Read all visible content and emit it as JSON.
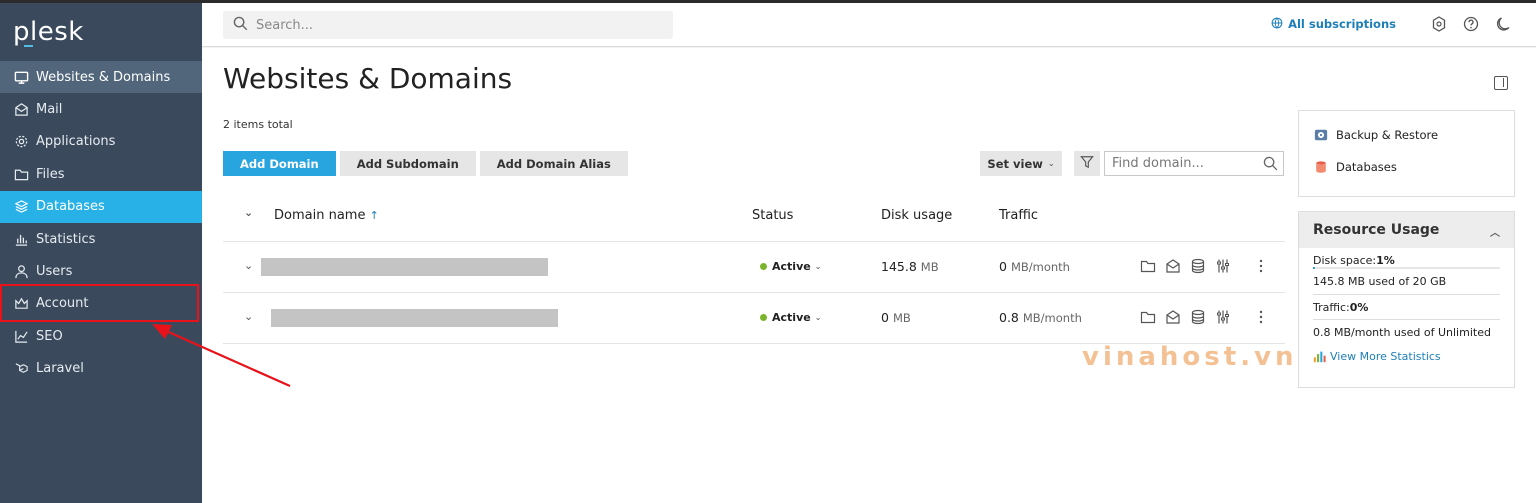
{
  "brand": {
    "logo": "plesk"
  },
  "sidebar": {
    "items": [
      {
        "label": "Websites & Domains",
        "icon": "monitor-icon"
      },
      {
        "label": "Mail",
        "icon": "mail-icon"
      },
      {
        "label": "Applications",
        "icon": "gear-icon"
      },
      {
        "label": "Files",
        "icon": "folder-icon"
      },
      {
        "label": "Databases",
        "icon": "layers-icon"
      },
      {
        "label": "Statistics",
        "icon": "bar-chart-icon"
      },
      {
        "label": "Users",
        "icon": "user-icon"
      },
      {
        "label": "Account",
        "icon": "crown-icon"
      },
      {
        "label": "SEO",
        "icon": "trend-icon"
      },
      {
        "label": "Laravel",
        "icon": "laravel-icon"
      }
    ]
  },
  "header": {
    "search_placeholder": "Search...",
    "subscriptions": "All subscriptions"
  },
  "main": {
    "title": "Websites & Domains",
    "items_total": "2 items total",
    "buttons": {
      "add_domain": "Add Domain",
      "add_subdomain": "Add Subdomain",
      "add_alias": "Add Domain Alias",
      "set_view": "Set view"
    },
    "find_placeholder": "Find domain...",
    "table": {
      "columns": {
        "domain": "Domain name",
        "sort_arrow": "↑",
        "status": "Status",
        "disk": "Disk usage",
        "traffic": "Traffic"
      },
      "rows": [
        {
          "status": "Active",
          "disk_value": "145.8",
          "disk_unit": "MB",
          "traffic_value": "0",
          "traffic_unit": "MB/month"
        },
        {
          "status": "Active",
          "disk_value": "0",
          "disk_unit": "MB",
          "traffic_value": "0.8",
          "traffic_unit": "MB/month"
        }
      ]
    },
    "watermark": "vinahost.vn"
  },
  "quick_links": [
    {
      "label": "Backup & Restore",
      "icon": "backup-icon"
    },
    {
      "label": "Databases",
      "icon": "database-icon"
    }
  ],
  "resource_usage": {
    "title": "Resource Usage",
    "disk_label": "Disk space: ",
    "disk_percent": "1%",
    "disk_fraction": 0.01,
    "disk_detail": "145.8 MB used of 20 GB",
    "traffic_label": "Traffic: ",
    "traffic_percent": "0%",
    "traffic_detail": "0.8 MB/month used of Unlimited",
    "more_link": "View More Statistics"
  },
  "colors": {
    "sidebar_bg": "#3a4a5c",
    "sidebar_selected": "#51667b",
    "sidebar_highlight": "#28b1e6",
    "primary": "#28a4de",
    "link": "#1d7fb8",
    "active": "#7ab42d",
    "annotation": "#e8121a"
  }
}
